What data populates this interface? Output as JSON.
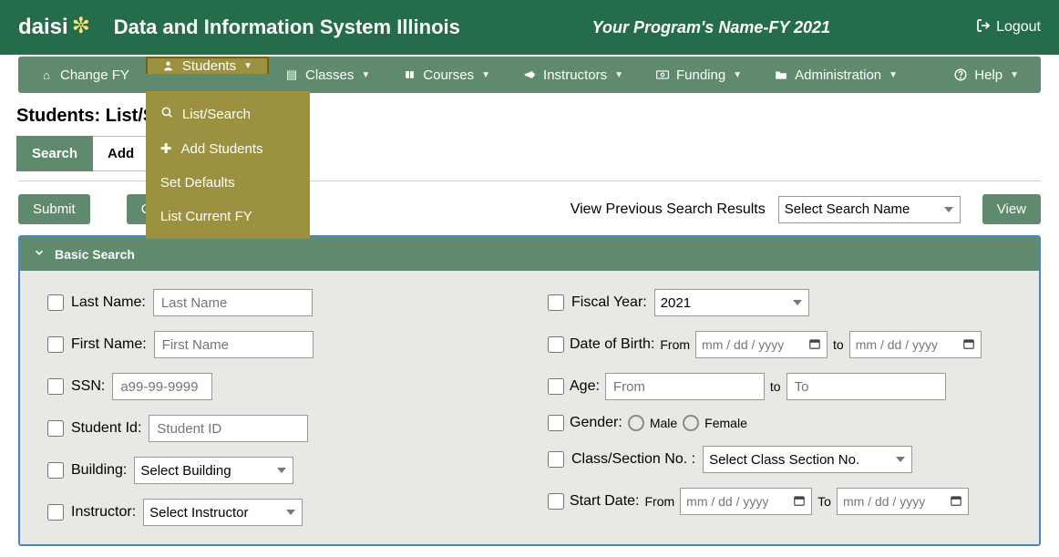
{
  "header": {
    "logo_text": "daisi",
    "title": "Data and Information System Illinois",
    "program": "Your Program's Name-FY 2021",
    "logout": "Logout"
  },
  "nav": {
    "change_fy": "Change FY",
    "students": "Students",
    "classes": "Classes",
    "courses": "Courses",
    "instructors": "Instructors",
    "funding": "Funding",
    "administration": "Administration",
    "help": "Help"
  },
  "dropdown": {
    "list_search": "List/Search",
    "add_students": "Add Students",
    "set_defaults": "Set Defaults",
    "list_current_fy": "List Current FY"
  },
  "page": {
    "title": "Students: List/Search"
  },
  "tabs": {
    "search": "Search",
    "add": "Add"
  },
  "actions": {
    "submit": "Submit",
    "clear": "Clear",
    "view_previous_label": "View Previous Search Results",
    "select_search_name": "Select Search Name",
    "view": "View"
  },
  "panel": {
    "title": "Basic Search"
  },
  "fields": {
    "last_name": {
      "label": "Last Name:",
      "placeholder": "Last Name"
    },
    "first_name": {
      "label": "First Name:",
      "placeholder": "First Name"
    },
    "ssn": {
      "label": "SSN:",
      "placeholder": "a99-99-9999"
    },
    "student_id": {
      "label": "Student Id:",
      "placeholder": "Student ID"
    },
    "building": {
      "label": "Building:",
      "placeholder": "Select Building"
    },
    "instructor": {
      "label": "Instructor:",
      "placeholder": "Select Instructor"
    },
    "fiscal_year": {
      "label": "Fiscal Year:",
      "value": "2021"
    },
    "dob": {
      "label": "Date of Birth:",
      "from": "From",
      "to": "to",
      "placeholder": "mm / dd / yyyy"
    },
    "age": {
      "label": "Age:",
      "from_ph": "From",
      "to": "to",
      "to_ph": "To"
    },
    "gender": {
      "label": "Gender:",
      "male": "Male",
      "female": "Female"
    },
    "class_section": {
      "label": "Class/Section No. :",
      "placeholder": "Select Class Section No."
    },
    "start_date": {
      "label": "Start Date:",
      "from": "From",
      "to": "To",
      "placeholder": "mm / dd / yyyy"
    }
  }
}
